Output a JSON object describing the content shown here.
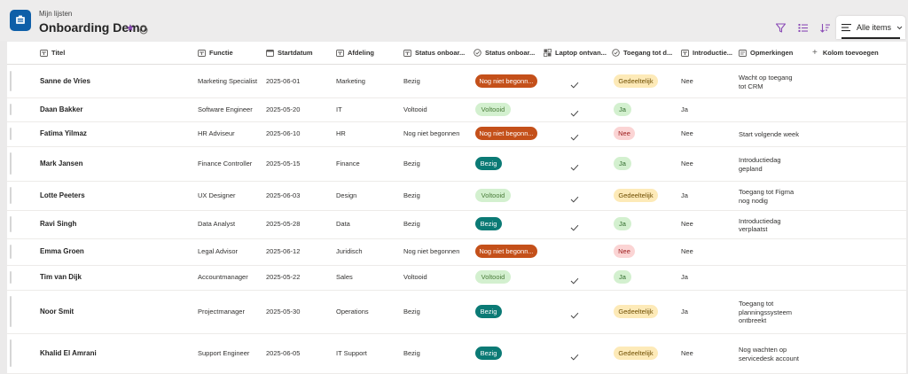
{
  "header": {
    "breadcrumb": "Mijn lijsten",
    "title": "Onboarding Demo",
    "view_label": "Alle items"
  },
  "columns": [
    {
      "label": "Titel",
      "icon": "text-icon"
    },
    {
      "label": "Functie",
      "icon": "text-icon"
    },
    {
      "label": "Startdatum",
      "icon": "calendar-icon"
    },
    {
      "label": "Afdeling",
      "icon": "text-icon"
    },
    {
      "label": "Status onboar...",
      "icon": "text-icon"
    },
    {
      "label": "Status onboar...",
      "icon": "choice-icon"
    },
    {
      "label": "Laptop ontvan...",
      "icon": "yesno-icon"
    },
    {
      "label": "Toegang tot d...",
      "icon": "choice-icon"
    },
    {
      "label": "Introductie...",
      "icon": "text-icon"
    },
    {
      "label": "Opmerkingen",
      "icon": "multiline-icon"
    }
  ],
  "add_column_label": "Kolom toevoegen",
  "colors": {
    "nog_niet": "#c4501a",
    "voltooid_bg": "#d3f0cf",
    "voltooid_fg": "#4a7c3a",
    "bezig": "#0b7a75",
    "gedeeltelijk_bg": "#fdeab8",
    "gedeeltelijk_fg": "#6e4d00",
    "ja_bg": "#d3f0cf",
    "ja_fg": "#2f6a2a",
    "nee_bg": "#fbd4d4",
    "nee_fg": "#9b1c1c"
  },
  "rows": [
    {
      "titel": "Sanne de Vries",
      "functie": "Marketing Specialist",
      "startdatum": "2025-06-01",
      "afdeling": "Marketing",
      "status_text": "Bezig",
      "status_pill": "Nog niet begonn...",
      "laptop": true,
      "toegang": "Gedeeltelijk",
      "introductie": "Nee",
      "opmerkingen": [
        "Wacht op toegang",
        "tot CRM"
      ]
    },
    {
      "titel": "Daan Bakker",
      "functie": "Software Engineer",
      "startdatum": "2025-05-20",
      "afdeling": "IT",
      "status_text": "Voltooid",
      "status_pill": "Voltooid",
      "laptop": true,
      "toegang": "Ja",
      "introductie": "Ja",
      "opmerkingen": []
    },
    {
      "titel": "Fatima Yilmaz",
      "functie": "HR Adviseur",
      "startdatum": "2025-06-10",
      "afdeling": "HR",
      "status_text": "Nog niet begonnen",
      "status_pill": "Nog niet begonn...",
      "laptop": true,
      "toegang": "Nee",
      "introductie": "Nee",
      "opmerkingen": [
        "Start volgende week"
      ]
    },
    {
      "titel": "Mark Jansen",
      "functie": "Finance Controller",
      "startdatum": "2025-05-15",
      "afdeling": "Finance",
      "status_text": "Bezig",
      "status_pill": "Bezig",
      "laptop": true,
      "toegang": "Ja",
      "introductie": "Nee",
      "opmerkingen": [
        "Introductiedag",
        "gepland"
      ]
    },
    {
      "titel": "Lotte Peeters",
      "functie": "UX Designer",
      "startdatum": "2025-06-03",
      "afdeling": "Design",
      "status_text": "Bezig",
      "status_pill": "Voltooid",
      "laptop": true,
      "toegang": "Gedeeltelijk",
      "introductie": "Ja",
      "opmerkingen": [
        "Toegang tot Figma",
        "nog nodig"
      ]
    },
    {
      "titel": "Ravi Singh",
      "functie": "Data Analyst",
      "startdatum": "2025-05-28",
      "afdeling": "Data",
      "status_text": "Bezig",
      "status_pill": "Bezig",
      "laptop": true,
      "toegang": "Ja",
      "introductie": "Nee",
      "opmerkingen": [
        "Introductiedag",
        "verplaatst"
      ]
    },
    {
      "titel": "Emma Groen",
      "functie": "Legal Advisor",
      "startdatum": "2025-06-12",
      "afdeling": "Juridisch",
      "status_text": "Nog niet begonnen",
      "status_pill": "Nog niet begonn...",
      "laptop": false,
      "toegang": "Nee",
      "introductie": "Nee",
      "opmerkingen": []
    },
    {
      "titel": "Tim van Dijk",
      "functie": "Accountmanager",
      "startdatum": "2025-05-22",
      "afdeling": "Sales",
      "status_text": "Voltooid",
      "status_pill": "Voltooid",
      "laptop": true,
      "toegang": "Ja",
      "introductie": "Ja",
      "opmerkingen": []
    },
    {
      "titel": "Noor Smit",
      "functie": "Projectmanager",
      "startdatum": "2025-05-30",
      "afdeling": "Operations",
      "status_text": "Bezig",
      "status_pill": "Bezig",
      "laptop": true,
      "toegang": "Gedeeltelijk",
      "introductie": "Ja",
      "opmerkingen": [
        "Toegang tot",
        "planningssysteem",
        "ontbreekt"
      ]
    },
    {
      "titel": "Khalid El Amrani",
      "functie": "Support Engineer",
      "startdatum": "2025-06-05",
      "afdeling": "IT Support",
      "status_text": "Bezig",
      "status_pill": "Bezig",
      "laptop": true,
      "toegang": "Gedeeltelijk",
      "introductie": "Nee",
      "opmerkingen": [
        "Nog wachten op",
        "servicedesk account"
      ]
    }
  ]
}
